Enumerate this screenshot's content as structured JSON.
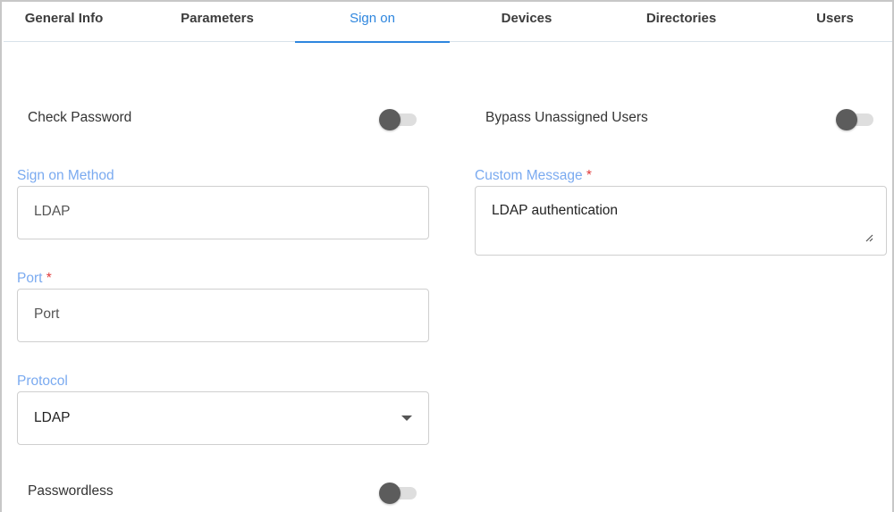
{
  "tabs": [
    {
      "label": "General Info"
    },
    {
      "label": "Parameters"
    },
    {
      "label": "Sign on",
      "active": true
    },
    {
      "label": "Devices"
    },
    {
      "label": "Directories"
    },
    {
      "label": "Users"
    }
  ],
  "form": {
    "check_password": {
      "label": "Check Password",
      "on": false
    },
    "bypass_unassigned": {
      "label": "Bypass Unassigned Users",
      "on": false
    },
    "sign_on_method": {
      "label": "Sign on Method",
      "value": "LDAP"
    },
    "custom_message": {
      "label": "Custom Message",
      "required_mark": "*",
      "value": "LDAP authentication"
    },
    "port": {
      "label": "Port",
      "required_mark": "*",
      "placeholder": "Port"
    },
    "protocol": {
      "label": "Protocol",
      "value": "LDAP"
    },
    "passwordless": {
      "label": "Passwordless",
      "on": false
    }
  },
  "colors": {
    "accent": "#2e86de",
    "field_label": "#7aaaf0",
    "required": "#e03a3a",
    "toggle_knob": "#5c5c5c",
    "toggle_track": "#dedede"
  }
}
